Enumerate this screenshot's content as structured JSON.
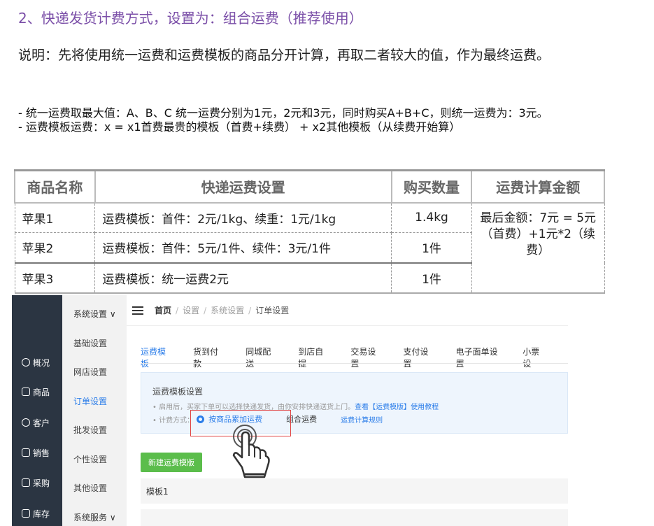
{
  "heading": "2、快递发货计费方式，设置为：组合运费（推荐使用）",
  "description": "说明：先将使用统一运费和运费模板的商品分开计算，再取二者较大的值，作为最终运费。",
  "bullets": [
    "- 统一运费取最大值：A、B、C 统一运费分别为1元，2元和3元，同时购买A+B+C，则统一运费为：3元。",
    "- 运费模板运费：x = x1首费最贵的模板（首费+续费） + x2其他模板（从续费开始算）"
  ],
  "table": {
    "headers": [
      "商品名称",
      "快递运费设置",
      "购买数量",
      "运费计算金额"
    ],
    "rows": [
      {
        "name": "苹果1",
        "setting": "运费模板：首件：2元/1kg、续重：1元/1kg",
        "qty": "1.4kg"
      },
      {
        "name": "苹果2",
        "setting": "运费模板：首件：5元/1件、续件：3元/1件",
        "qty": "1件"
      },
      {
        "name": "苹果3",
        "setting": "运费模板：统一运费2元",
        "qty": "1件"
      }
    ],
    "merged_result": "最后金额：7元 = 5元（首费）+1元*2（续费）"
  },
  "screenshot": {
    "nav": [
      {
        "label": "概况",
        "icon": "gauge-icon"
      },
      {
        "label": "商品",
        "icon": "grid-icon"
      },
      {
        "label": "客户",
        "icon": "user-icon"
      },
      {
        "label": "销售",
        "icon": "receipt-icon"
      },
      {
        "label": "采购",
        "icon": "cart-icon"
      },
      {
        "label": "库存",
        "icon": "box-icon"
      }
    ],
    "sub_head": "系统设置 ∨",
    "sub_items": [
      "基础设置",
      "网店设置",
      "订单设置",
      "批发设置",
      "个性设置",
      "其他设置"
    ],
    "sub_active": "订单设置",
    "sub_footer": "系统服务 ∨",
    "breadcrumb": [
      "首页",
      "设置",
      "系统设置",
      "订单设置"
    ],
    "tabs": [
      "运费模板",
      "货到付款",
      "同城配送",
      "到店自提",
      "交易设置",
      "支付设置",
      "电子面单设置",
      "小票设"
    ],
    "active_tab": "运费模板",
    "info_title": "运费模板设置",
    "info_line1_prefix": "• 启用后，买家下单可以选择快递发货，由你安排快递送货上门。",
    "info_line1_link": "查看【运费模版】使用教程",
    "info_line2_prefix": "• 计费方式：",
    "option_selected": "按商品累加运费",
    "option_other": "组合运费",
    "rules_link": "运费计算规则",
    "new_button": "新建运费模版",
    "template_row": "模板1",
    "accent": "#2b7de9",
    "button_color": "#5bbd4b",
    "sidebar_color": "#2b3542"
  }
}
